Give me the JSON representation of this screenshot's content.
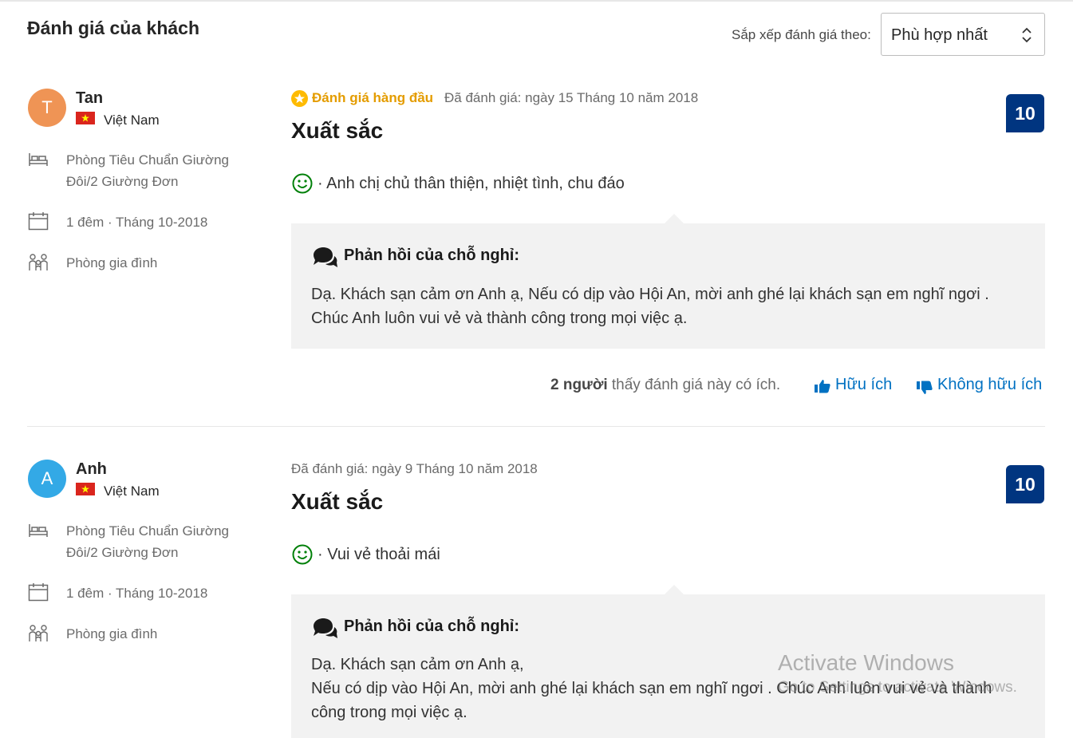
{
  "header": {
    "title": "Đánh giá của khách",
    "sort_label": "Sắp xếp đánh giá theo:",
    "sort_value": "Phù hợp nhất"
  },
  "reviews": [
    {
      "avatar_initial": "T",
      "avatar_color": "#ef9455",
      "name": "Tan",
      "country": "Việt Nam",
      "room": "Phòng Tiêu Chuẩn Giường Đôi/2 Giường Đơn",
      "stay": "1 đêm ·  Tháng 10-2018",
      "traveler_type": "Phòng gia đình",
      "top_label": "Đánh giá hàng đầu",
      "date": "Đã đánh giá: ngày 15 Tháng 10 năm 2018",
      "title": "Xuất sắc",
      "score": "10",
      "positive": "· Anh chị chủ thân thiện, nhiệt tình, chu đáo",
      "reply_title": "Phản hồi của chỗ nghỉ:",
      "reply_text": "Dạ. Khách sạn cảm ơn Anh ạ, Nếu có dịp vào Hội An, mời anh ghé lại khách sạn em nghĩ ngơi .\nChúc Anh luôn vui vẻ và thành công trong mọi việc ạ.",
      "helpful_count": "2 người",
      "helpful_suffix": " thấy đánh giá này có ích.",
      "helpful_btn": "Hữu ích",
      "unhelpful_btn": "Không hữu ích"
    },
    {
      "avatar_initial": "A",
      "avatar_color": "#33a9e6",
      "name": "Anh",
      "country": "Việt Nam",
      "room": "Phòng Tiêu Chuẩn Giường Đôi/2 Giường Đơn",
      "stay": "1 đêm ·  Tháng 10-2018",
      "traveler_type": "Phòng gia đình",
      "date": "Đã đánh giá: ngày 9 Tháng 10 năm 2018",
      "title": "Xuất sắc",
      "score": "10",
      "positive": "·  Vui vẻ thoải mái",
      "reply_title": "Phản hồi của chỗ nghỉ:",
      "reply_text": "Dạ. Khách sạn cảm ơn Anh ạ,\nNếu có dịp vào Hội An, mời anh ghé lại khách sạn em nghĩ ngơi . Chúc Anh luôn vui vẻ và thành\ncông trong mọi việc ạ."
    }
  ],
  "watermark": {
    "title": "Activate Windows",
    "subtitle": "Go to Settings to activate Windows."
  },
  "colors": {
    "accent": "#0071c2",
    "score_bg": "#003580",
    "top_reviewer": "#e49c00",
    "smile": "#008009"
  }
}
